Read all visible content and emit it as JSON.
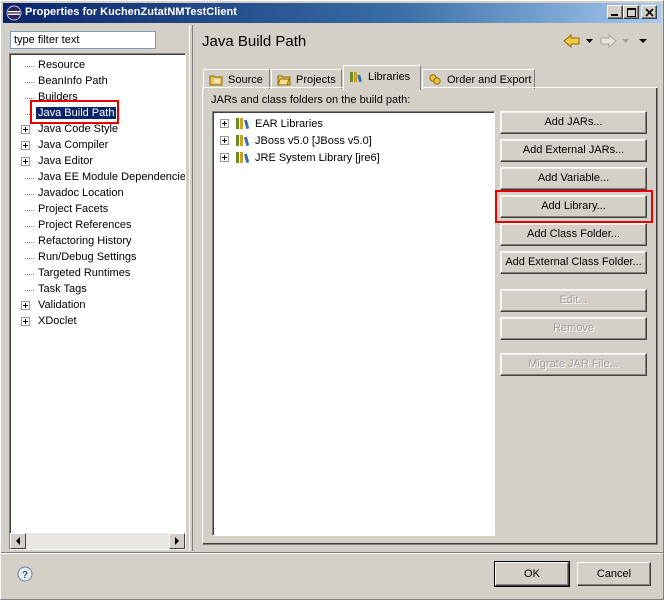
{
  "window": {
    "title": "Properties for KuchenZutatNMTestClient",
    "controls": [
      "minimize",
      "maximize",
      "close"
    ]
  },
  "filter": {
    "value": "type filter text"
  },
  "tree": {
    "items": [
      {
        "label": "Resource",
        "expandable": false
      },
      {
        "label": "BeanInfo Path",
        "expandable": false
      },
      {
        "label": "Builders",
        "expandable": false
      },
      {
        "label": "Java Build Path",
        "expandable": false,
        "selected": true
      },
      {
        "label": "Java Code Style",
        "expandable": true
      },
      {
        "label": "Java Compiler",
        "expandable": true
      },
      {
        "label": "Java Editor",
        "expandable": true
      },
      {
        "label": "Java EE Module Dependencies",
        "expandable": false
      },
      {
        "label": "Javadoc Location",
        "expandable": false
      },
      {
        "label": "Project Facets",
        "expandable": false
      },
      {
        "label": "Project References",
        "expandable": false
      },
      {
        "label": "Refactoring History",
        "expandable": false
      },
      {
        "label": "Run/Debug Settings",
        "expandable": false
      },
      {
        "label": "Targeted Runtimes",
        "expandable": false
      },
      {
        "label": "Task Tags",
        "expandable": false
      },
      {
        "label": "Validation",
        "expandable": true
      },
      {
        "label": "XDoclet",
        "expandable": true
      }
    ]
  },
  "page": {
    "title": "Java Build Path"
  },
  "tabs": [
    {
      "label": "Source",
      "icon": "source-folder-icon"
    },
    {
      "label": "Projects",
      "icon": "projects-folder-icon"
    },
    {
      "label": "Libraries",
      "icon": "libraries-icon",
      "active": true
    },
    {
      "label": "Order and Export",
      "icon": "order-export-icon"
    }
  ],
  "libraries": {
    "caption": "JARs and class folders on the build path:",
    "items": [
      {
        "label": "EAR Libraries"
      },
      {
        "label": "JBoss v5.0 [JBoss v5.0]"
      },
      {
        "label": "JRE System Library [jre6]"
      }
    ]
  },
  "buttons": {
    "add_jars": "Add JARs...",
    "add_external_jars": "Add External JARs...",
    "add_variable": "Add Variable...",
    "add_library": "Add Library...",
    "add_class_folder": "Add Class Folder...",
    "add_external_class_folder": "Add External Class Folder...",
    "edit": "Edit...",
    "remove": "Remove",
    "migrate_jar": "Migrate JAR File..."
  },
  "dialog": {
    "ok": "OK",
    "cancel": "Cancel"
  },
  "colors": {
    "selection": "#0a246a",
    "highlight_box": "#e60000",
    "title_bar": "#0a246a"
  }
}
